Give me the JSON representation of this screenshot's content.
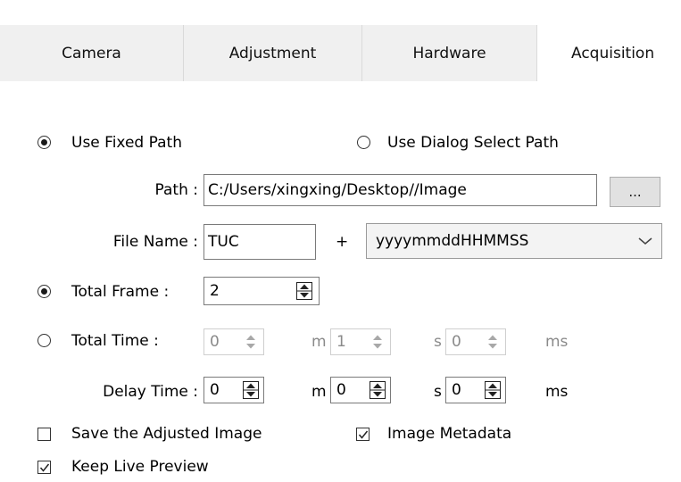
{
  "tabs": [
    {
      "label": "Camera",
      "active": false
    },
    {
      "label": "Adjustment",
      "active": false
    },
    {
      "label": "Hardware",
      "active": false
    },
    {
      "label": "Acquisition",
      "active": true
    }
  ],
  "path_mode": {
    "fixed_label": "Use Fixed Path",
    "dialog_label": "Use Dialog Select Path",
    "selected": "fixed"
  },
  "path": {
    "label": "Path :",
    "value": "C:/Users/xingxing/Desktop//Image",
    "browse_label": "..."
  },
  "file_name": {
    "label": "File Name :",
    "prefix": "TUC",
    "plus": "+",
    "format": "yyyymmddHHMMSS"
  },
  "total_frame": {
    "label": "Total Frame :",
    "value": "2",
    "selected": true
  },
  "total_time": {
    "label": "Total Time :",
    "minutes": "0",
    "seconds": "1",
    "milliseconds": "0",
    "unit_m": "m",
    "unit_s": "s",
    "unit_ms": "ms",
    "selected": false,
    "enabled": false
  },
  "delay_time": {
    "label": "Delay Time :",
    "minutes": "0",
    "seconds": "0",
    "milliseconds": "0",
    "unit_m": "m",
    "unit_s": "s",
    "unit_ms": "ms"
  },
  "options": {
    "save_adjusted_label": "Save the Adjusted Image",
    "save_adjusted_checked": false,
    "metadata_label": "Image Metadata",
    "metadata_checked": true,
    "live_preview_label": "Keep Live Preview",
    "live_preview_checked": true
  },
  "colors": {
    "tab_bg": "#f0f0f0",
    "active_tab_bg": "#ffffff",
    "disabled_text": "#8a8a8a",
    "border": "#7a7a7a"
  },
  "icons": {
    "browse": "ellipsis-icon",
    "dropdown": "chevron-down-icon",
    "spinner": "spinner-arrows-icon",
    "check": "checkmark-icon"
  }
}
